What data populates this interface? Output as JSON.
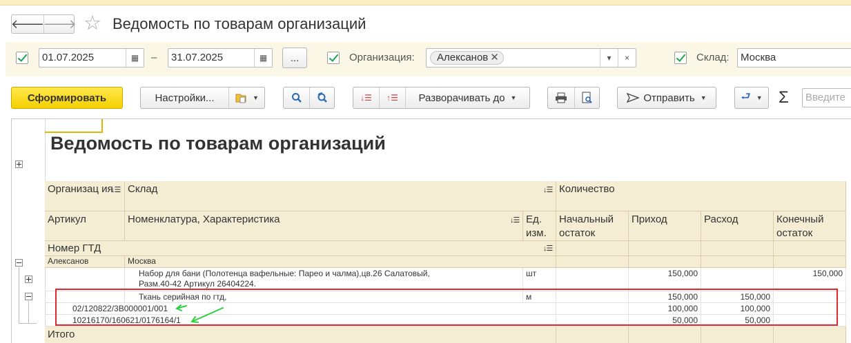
{
  "window": {
    "title": "Ведомость по товарам организаций",
    "back_icon": "arrow-left-icon",
    "forward_icon": "arrow-right-icon",
    "favorite_icon": "star-icon"
  },
  "filters": {
    "date_from": "01.07.2025",
    "date_to": "31.07.2025",
    "dash": "–",
    "period_button": "...",
    "org_label": "Организация:",
    "org_value": "Алексанов",
    "clear_label": "×",
    "warehouse_label": "Склад:",
    "warehouse_value": "Москва"
  },
  "toolbar": {
    "generate": "Сформировать",
    "settings": "Настройки...",
    "expand_to": "Разворачивать до",
    "send": "Отправить",
    "search_placeholder": "Введите",
    "sum": "Σ"
  },
  "report": {
    "title": "Ведомость по товарам организаций",
    "headers": {
      "organization": "Организац ия",
      "warehouse": "Склад",
      "quantity": "Количество",
      "article": "Артикул",
      "nomenclature": "Номенклатура, Характеристика",
      "unit": "Ед. изм.",
      "opening": "Начальный остаток",
      "income": "Приход",
      "outcome": "Расход",
      "closing": "Конечный остаток",
      "gtd": "Номер ГТД"
    },
    "group_row": {
      "organization": "Алексанов",
      "warehouse": "Москва"
    },
    "rows": [
      {
        "name_line1": "Набор для бани (Полотенца вафельные: Парео и чалма),цв.26 Салатовый,",
        "name_line2": "Разм.40-42 Артикул 26404224.",
        "unit": "шт",
        "opening": "",
        "income": "150,000",
        "outcome": "",
        "closing": "150,000"
      },
      {
        "name": "Ткань серийная по гтд,",
        "unit": "м",
        "opening": "",
        "income": "150,000",
        "outcome": "150,000",
        "closing": ""
      }
    ],
    "gtd_rows": [
      {
        "number": "02/120822/3В000001/001",
        "income": "100,000",
        "outcome": "100,000"
      },
      {
        "number": "10216170/160621/0176164/1",
        "income": "50,000",
        "outcome": "50,000"
      }
    ],
    "total_label": "Итого"
  },
  "colors": {
    "primary_button": "#f4cf00",
    "header_bg": "#f4edd3",
    "filter_bg": "#fbf7e6",
    "annotation_box": "#e0282e",
    "annotation_arrow": "#2bd13a",
    "checkbox": "#1aa54c"
  }
}
